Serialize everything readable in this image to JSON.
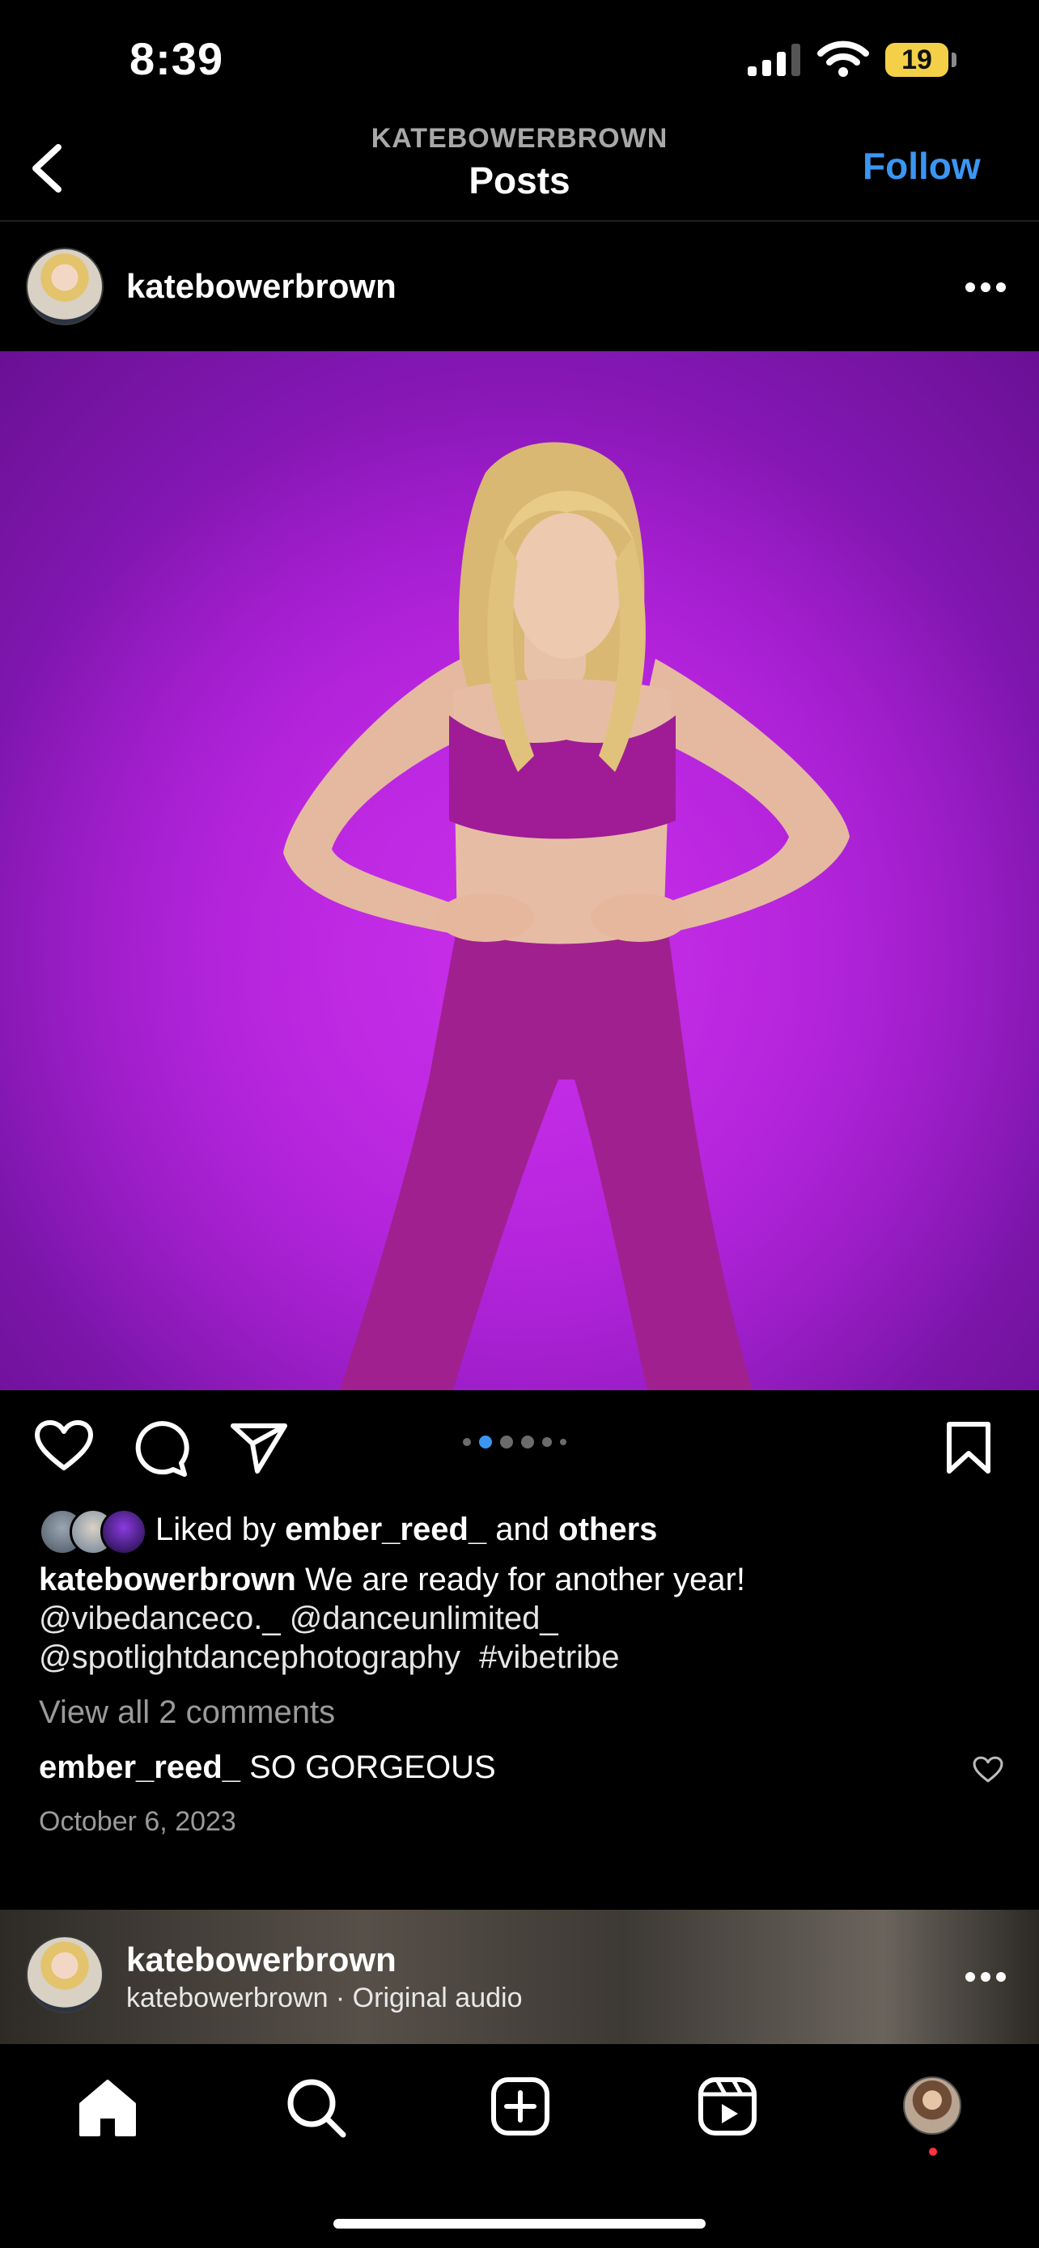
{
  "status_bar": {
    "time": "8:39",
    "battery": "19"
  },
  "header": {
    "account": "KATEBOWERBROWN",
    "title": "Posts",
    "follow_label": "Follow"
  },
  "post": {
    "author": "katebowerbrown",
    "carousel": {
      "total": 6,
      "active_index": 1,
      "color_active": "#3b96f2"
    },
    "likes": {
      "prefix": "Liked by",
      "user": "ember_reed_",
      "conjunction": "and",
      "others": "others"
    },
    "caption": {
      "author": "katebowerbrown",
      "text": "We are ready for another year!",
      "mention_1": "@vibedanceco._",
      "mention_2": "@danceunlimited_",
      "mention_3": "@spotlightdancephotography",
      "hashtag": "#vibetribe"
    },
    "view_comments": "View all 2 comments",
    "top_comment": {
      "user": "ember_reed_",
      "text": "SO GORGEOUS"
    },
    "date": "October 6, 2023",
    "photo_background": "#b21ed8"
  },
  "next_post": {
    "author": "katebowerbrown",
    "audio": "katebowerbrown · Original audio"
  },
  "tab_bar": {
    "items": [
      "home",
      "search",
      "create",
      "reels",
      "profile"
    ]
  }
}
